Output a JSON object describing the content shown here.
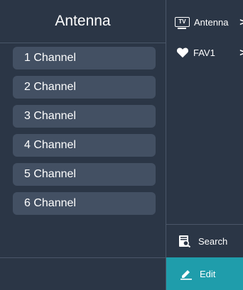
{
  "panel": {
    "title": "Antenna",
    "channels": [
      {
        "label": "1 Channel"
      },
      {
        "label": "2 Channel"
      },
      {
        "label": "3 Channel"
      },
      {
        "label": "4 Channel"
      },
      {
        "label": "5 Channel"
      },
      {
        "label": "6 Channel"
      }
    ]
  },
  "sidebar": {
    "items": [
      {
        "label": "Antenna",
        "icon": "tv-icon",
        "icon_text": "TV"
      },
      {
        "label": "FAV1",
        "icon": "heart-icon"
      }
    ],
    "chevron": ">",
    "search_label": "Search",
    "edit_label": "Edit"
  },
  "colors": {
    "background": "#2b3646",
    "channel_item": "#435063",
    "accent": "#1f9dab"
  }
}
